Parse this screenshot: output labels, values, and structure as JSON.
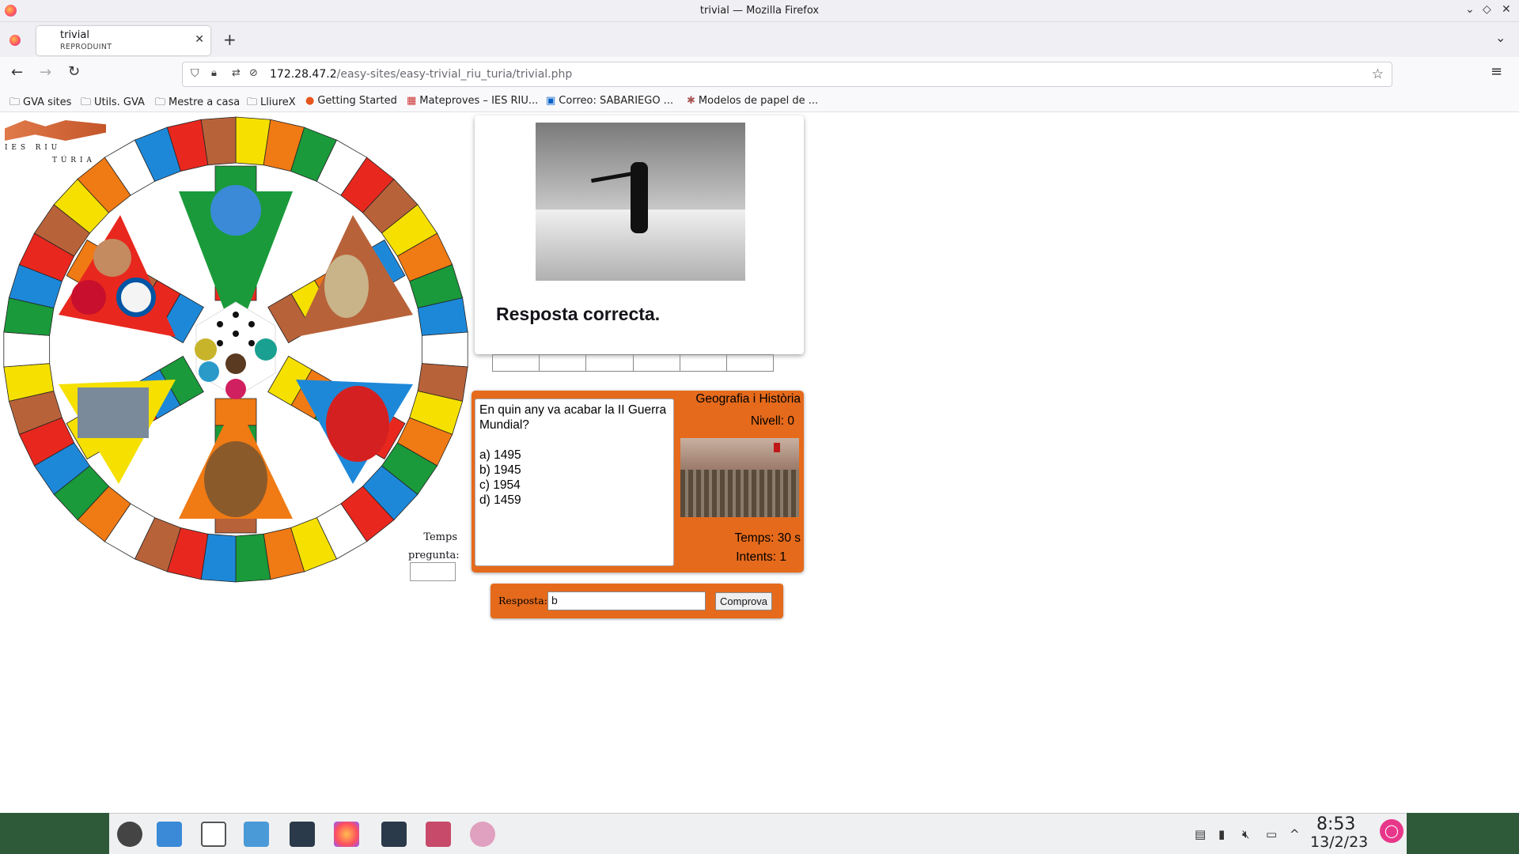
{
  "window": {
    "title": "trivial — Mozilla Firefox"
  },
  "tab": {
    "title": "trivial",
    "subtitle": "REPRODUINT"
  },
  "address": {
    "host": "172.28.47.2",
    "path": "/easy-sites/easy-trivial_riu_turia/trivial.php"
  },
  "bookmarks": [
    {
      "label": "GVA sites",
      "icon": "folder-icon"
    },
    {
      "label": "Utils. GVA",
      "icon": "folder-icon"
    },
    {
      "label": "Mestre a casa",
      "icon": "folder-icon"
    },
    {
      "label": "LliureX",
      "icon": "folder-icon"
    },
    {
      "label": "Getting Started",
      "icon": "firefox-icon"
    },
    {
      "label": "Mateproves – IES RIU...",
      "icon": "site-icon"
    },
    {
      "label": "Correo: SABARIEGO ...",
      "icon": "outlook-icon"
    },
    {
      "label": "Modelos de papel de ...",
      "icon": "site-icon"
    }
  ],
  "logo": {
    "line1": "I E S   R I U",
    "line2": "T Ú R I A"
  },
  "timer": {
    "label": "Temps pregunta:",
    "value": ""
  },
  "popup": {
    "message": "Resposta correcta."
  },
  "question": {
    "text": "En quin any va acabar la II Guerra Mundial?",
    "options": [
      "a) 1495",
      "b) 1945",
      "c) 1954",
      "d) 1459"
    ],
    "category": "Geografia i Història",
    "level": "Nivell: 0",
    "time": "Temps: 30 s",
    "attempts": "Intents: 1"
  },
  "answer": {
    "label": "Resposta:",
    "value": "b",
    "button": "Comprova"
  },
  "clock": {
    "time": "8:53",
    "date": "13/2/23"
  },
  "colors": {
    "accent": "#e56a1c",
    "board_yellow": "#f5e000",
    "board_green": "#1a9a3a",
    "board_blue": "#1e88d8",
    "board_red": "#e8281e",
    "board_orange": "#f07a14",
    "board_brown": "#b8623a"
  }
}
